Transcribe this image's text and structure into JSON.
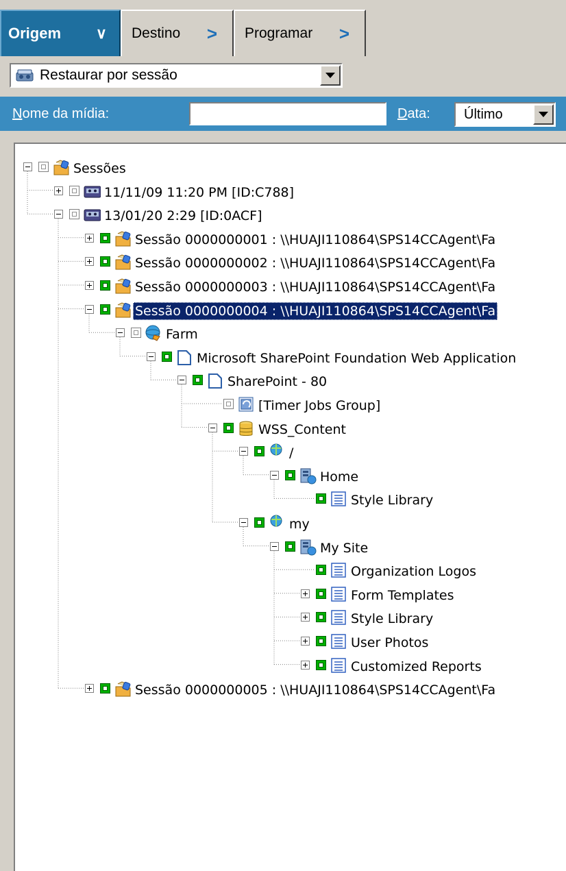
{
  "tabs": [
    {
      "label": "Origem",
      "active": true,
      "arrow": "chevron-down"
    },
    {
      "label": "Destino",
      "active": false,
      "arrow": "chevron-right"
    },
    {
      "label": "Programar",
      "active": false,
      "arrow": "chevron-right"
    }
  ],
  "restore_type": {
    "icon": "restore-session-icon",
    "value": "Restaurar por sessão"
  },
  "media_bar": {
    "media_name_label": "Nome da mídia:",
    "media_name_value": "",
    "date_label": "Data:",
    "date_value": "Último"
  },
  "tree": {
    "root_label": "Sessões",
    "nodes": [
      {
        "label": "Sessões",
        "icon": "session-folder-icon",
        "checked": false,
        "expander": "minus"
      },
      {
        "label": "11/11/09 11:20 PM [ID:C788]",
        "icon": "tape-media-icon",
        "checked": false,
        "expander": "plus"
      },
      {
        "label": "13/01/20 2:29 [ID:0ACF]",
        "icon": "tape-media-icon",
        "checked": false,
        "expander": "minus"
      },
      {
        "label": "Sessão 0000000001 : \\\\HUAJI110864\\SPS14CCAgent\\Fa",
        "icon": "session-folder-icon",
        "checked": true,
        "expander": "plus"
      },
      {
        "label": "Sessão 0000000002 : \\\\HUAJI110864\\SPS14CCAgent\\Fa",
        "icon": "session-folder-icon",
        "checked": true,
        "expander": "plus"
      },
      {
        "label": "Sessão 0000000003 : \\\\HUAJI110864\\SPS14CCAgent\\Fa",
        "icon": "session-folder-icon",
        "checked": true,
        "expander": "plus"
      },
      {
        "label": "Sessão 0000000004 : \\\\HUAJI110864\\SPS14CCAgent\\Fa",
        "icon": "session-folder-icon",
        "checked": true,
        "expander": "minus",
        "selected": true
      },
      {
        "label": "Farm",
        "icon": "farm-icon",
        "checked": false,
        "expander": "minus"
      },
      {
        "label": "Microsoft SharePoint Foundation Web Application",
        "icon": "web-application-icon",
        "checked": true,
        "expander": "minus"
      },
      {
        "label": "SharePoint - 80",
        "icon": "web-application-icon",
        "checked": true,
        "expander": "minus"
      },
      {
        "label": "[Timer Jobs Group]",
        "icon": "timer-jobs-icon",
        "checked": false,
        "expander": "none"
      },
      {
        "label": "WSS_Content",
        "icon": "database-icon",
        "checked": true,
        "expander": "minus"
      },
      {
        "label": "/",
        "icon": "site-collection-icon",
        "checked": true,
        "expander": "minus"
      },
      {
        "label": "Home",
        "icon": "site-icon",
        "checked": true,
        "expander": "minus"
      },
      {
        "label": "Style Library",
        "icon": "list-icon",
        "checked": true,
        "expander": "none"
      },
      {
        "label": "my",
        "icon": "site-collection-icon",
        "checked": true,
        "expander": "minus"
      },
      {
        "label": "My Site",
        "icon": "site-icon",
        "checked": true,
        "expander": "minus"
      },
      {
        "label": "Organization Logos",
        "icon": "list-icon",
        "checked": true,
        "expander": "none"
      },
      {
        "label": "Form Templates",
        "icon": "list-icon",
        "checked": true,
        "expander": "plus"
      },
      {
        "label": "Style Library",
        "icon": "list-icon",
        "checked": true,
        "expander": "plus"
      },
      {
        "label": "User Photos",
        "icon": "list-icon",
        "checked": true,
        "expander": "plus"
      },
      {
        "label": "Customized Reports",
        "icon": "list-icon",
        "checked": true,
        "expander": "plus"
      },
      {
        "label": "Sessão 0000000005 : \\\\HUAJI110864\\SPS14CCAgent\\Fa",
        "icon": "session-folder-icon",
        "checked": true,
        "expander": "plus"
      }
    ]
  }
}
